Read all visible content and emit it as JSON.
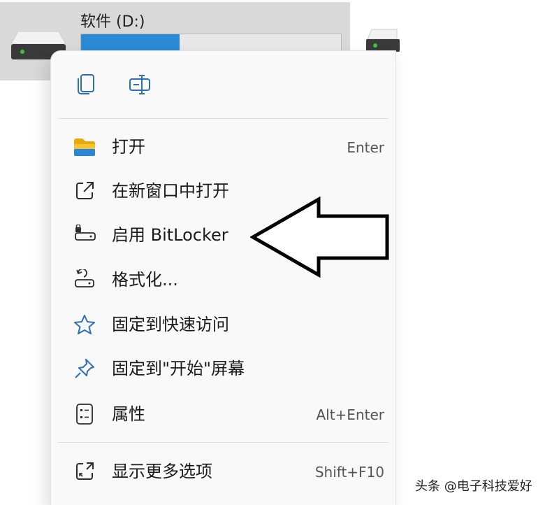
{
  "drive": {
    "name": "软件 (D:)",
    "used_fraction": 0.38
  },
  "menu": {
    "top_icons": [
      "copy-icon",
      "rename-icon"
    ],
    "items": [
      {
        "label": "打开",
        "shortcut": "Enter",
        "icon": "folder-icon"
      },
      {
        "label": "在新窗口中打开",
        "shortcut": "",
        "icon": "open-new-window-icon"
      },
      {
        "label": "启用 BitLocker",
        "shortcut": "",
        "icon": "bitlocker-icon"
      },
      {
        "label": "格式化...",
        "shortcut": "",
        "icon": "format-icon"
      },
      {
        "label": "固定到快速访问",
        "shortcut": "",
        "icon": "star-icon"
      },
      {
        "label": "固定到\"开始\"屏幕",
        "shortcut": "",
        "icon": "pin-icon"
      },
      {
        "label": "属性",
        "shortcut": "Alt+Enter",
        "icon": "properties-icon"
      },
      {
        "label": "显示更多选项",
        "shortcut": "Shift+F10",
        "icon": "show-more-icon"
      }
    ]
  },
  "annotation": "arrow-pointing-left",
  "watermark": "头条 @电子科技爱好"
}
